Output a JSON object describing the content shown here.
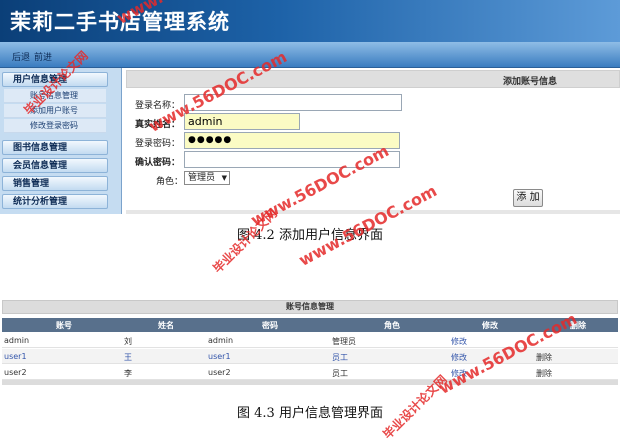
{
  "app": {
    "title": "茉莉二手书店管理系统",
    "nav": {
      "back": "后退",
      "forward": "前进"
    }
  },
  "sidebar": {
    "groups": [
      {
        "label": "用户信息管理",
        "items": [
          "账号信息管理",
          "添加用户账号",
          "修改登录密码"
        ]
      },
      {
        "label": "图书信息管理"
      },
      {
        "label": "会员信息管理"
      },
      {
        "label": "销售管理"
      },
      {
        "label": "统计分析管理"
      }
    ]
  },
  "add_form": {
    "title": "添加账号信息",
    "fields": {
      "login_name": {
        "label": "登录名称：",
        "value": ""
      },
      "real_name": {
        "label": "真实姓名：",
        "value": "admin"
      },
      "password": {
        "label": "登录密码：",
        "value": "●●●●●"
      },
      "confirm": {
        "label": "确认密码：",
        "value": ""
      },
      "role": {
        "label": "角色：",
        "value": "管理员"
      }
    },
    "submit_label": "添 加"
  },
  "captions": {
    "fig1": "图 4.2  添加用户信息界面",
    "fig2": "图 4.3  用户信息管理界面"
  },
  "account_table": {
    "title": "账号信息管理",
    "columns": [
      "账号",
      "姓名",
      "密码",
      "角色",
      "修改",
      "删除"
    ],
    "rows": [
      {
        "account": "admin",
        "name": "刘",
        "password": "admin",
        "role": "管理员",
        "edit": "修改",
        "delete": ""
      },
      {
        "account": "user1",
        "name": "王",
        "password": "user1",
        "role": "员工",
        "edit": "修改",
        "delete": "删除"
      },
      {
        "account": "user2",
        "name": "李",
        "password": "user2",
        "role": "员工",
        "edit": "修改",
        "delete": "删除"
      }
    ]
  },
  "watermarks": {
    "site": "www.56DOC.com",
    "cn": "毕业设计论文网"
  },
  "colors": {
    "header_dark": "#0b3f78",
    "table_header": "#58708c",
    "input_highlight": "#fbfbc4",
    "watermark": "#e52a2a"
  }
}
